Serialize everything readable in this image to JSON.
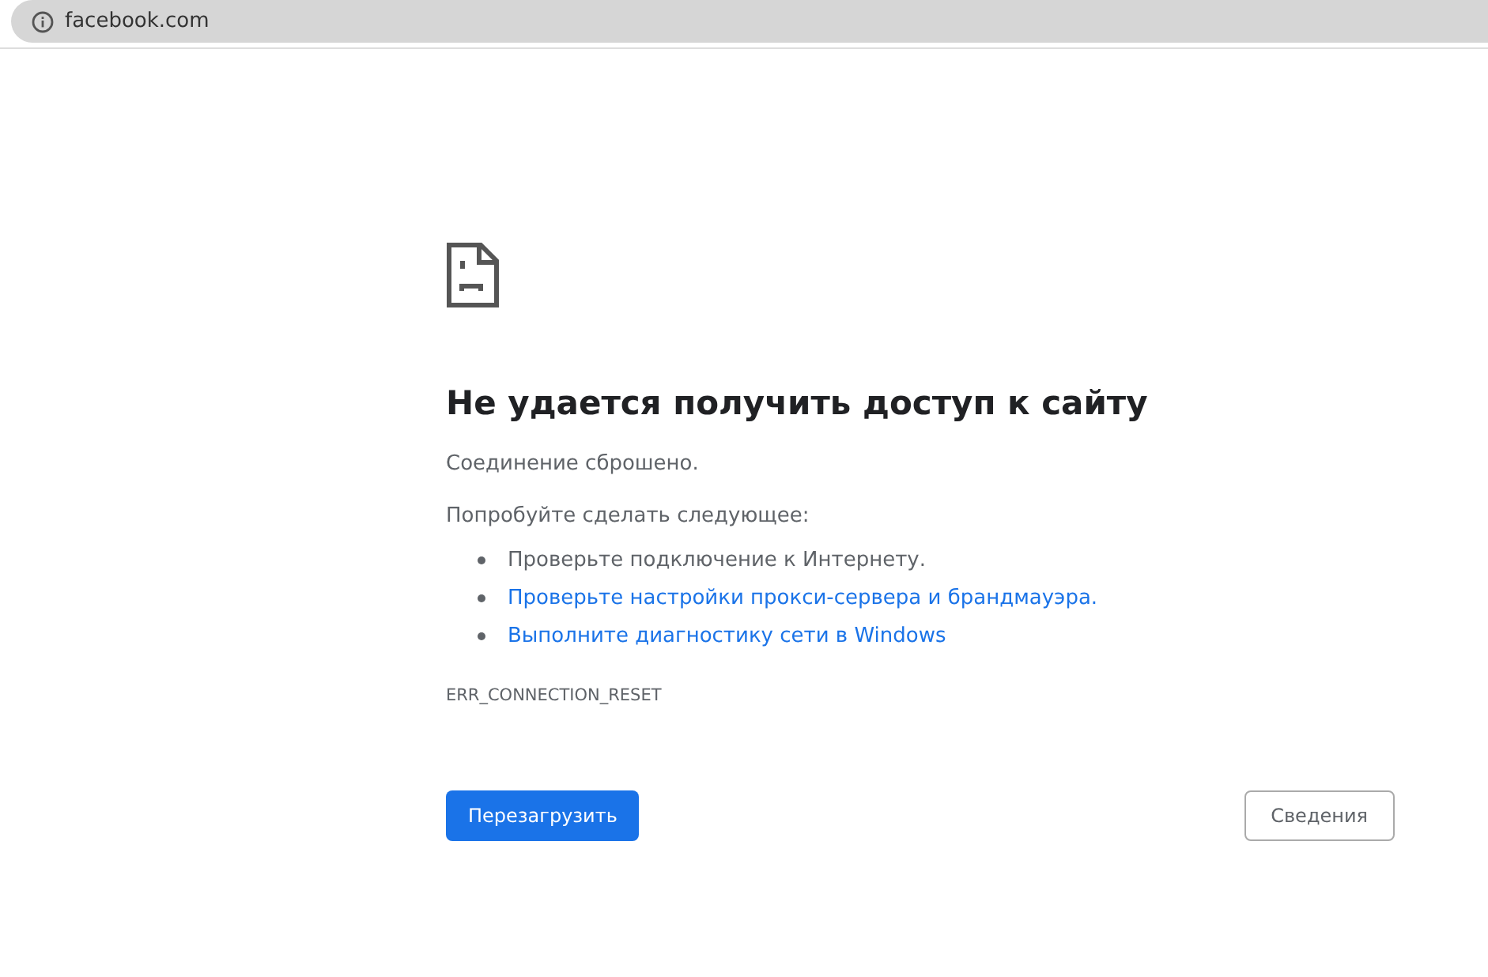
{
  "address_bar": {
    "url": "facebook.com"
  },
  "error": {
    "title": "Не удается получить доступ к сайту",
    "message": "Соединение сброшено.",
    "suggestions_heading": "Попробуйте сделать следующее:",
    "suggestions": [
      {
        "kind": "text",
        "text": "Проверьте подключение к Интернету."
      },
      {
        "kind": "link",
        "text": "Проверьте настройки прокси-сервера и брандмауэра."
      },
      {
        "kind": "link",
        "text": "Выполните диагностику сети в Windows"
      }
    ],
    "code": "ERR_CONNECTION_RESET"
  },
  "buttons": {
    "reload": "Перезагрузить",
    "details": "Сведения"
  }
}
